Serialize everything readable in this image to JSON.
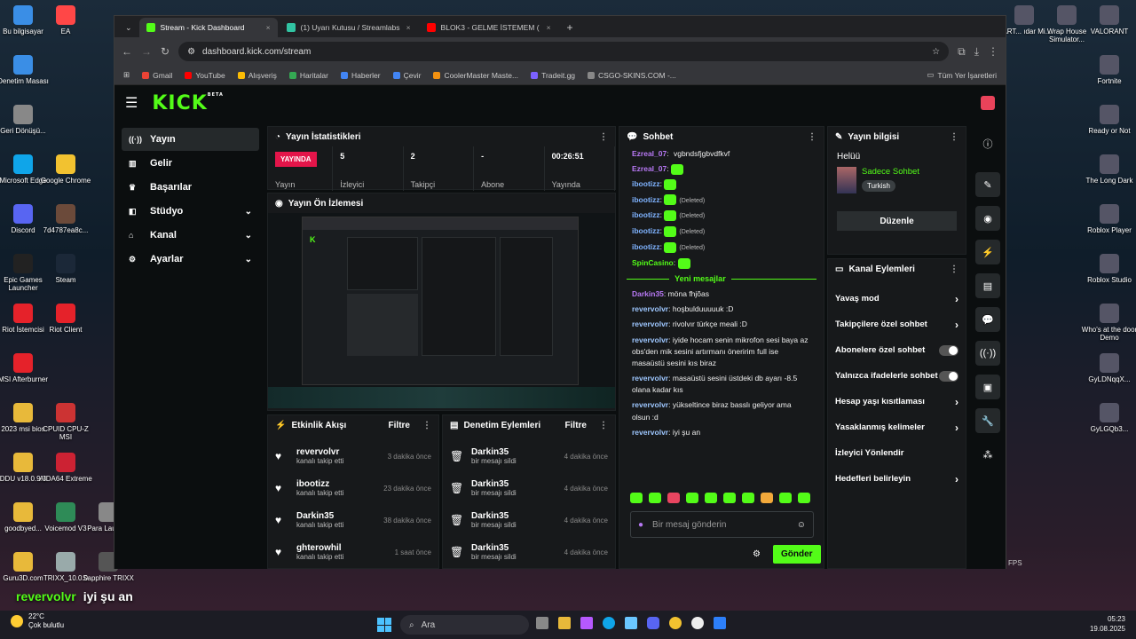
{
  "desktop": {
    "left_icons": [
      {
        "label": "Bu bilgisayar"
      },
      {
        "label": "EA"
      },
      {
        "label": "Denetim Masası"
      },
      {
        "label": "Geri Dönüşü..."
      },
      {
        "label": "Microsoft Edge"
      },
      {
        "label": "Google Chrome"
      },
      {
        "label": "Discord"
      },
      {
        "label": "7d4787ea8c..."
      },
      {
        "label": "Epic Games Launcher"
      },
      {
        "label": "Steam"
      },
      {
        "label": "Riot İstemcisi"
      },
      {
        "label": "Riot Client"
      },
      {
        "label": "MSI Afterburner"
      },
      {
        "label": "2023 msi bios"
      },
      {
        "label": "CPUID CPU-Z MSI"
      },
      {
        "label": "DDU v18.0.9.3"
      },
      {
        "label": "AIDA64 Extreme"
      },
      {
        "label": "goodbyed..."
      },
      {
        "label": "Voicemod V3"
      },
      {
        "label": "Para Launc..."
      },
      {
        "label": "Guru3D.com"
      },
      {
        "label": "TRIXX_10.0.0"
      },
      {
        "label": "Sapphire TRIXX"
      }
    ],
    "right_icons": [
      {
        "label": "HART... ıdar Mi..."
      },
      {
        "label": "Wrap House Simulator..."
      },
      {
        "label": "VALORANT"
      },
      {
        "label": "Fortnite"
      },
      {
        "label": "Ready or Not"
      },
      {
        "label": "The Long Dark"
      },
      {
        "label": "Roblox Player"
      },
      {
        "label": "Roblox Studio"
      },
      {
        "label": "Who's at the door Demo"
      },
      {
        "label": "GyLDNqqX..."
      },
      {
        "label": "GyLGQb3..."
      }
    ],
    "overlay_chat": {
      "user": "revervolvr",
      "message": "iyi şu an"
    },
    "fps_label": "FPS",
    "weather": {
      "temp": "22°C",
      "desc": "Çok bulutlu"
    },
    "taskbar": {
      "search_placeholder": "Ara",
      "time": "05:23",
      "date": "19.08.2025"
    }
  },
  "browser": {
    "tabs": [
      {
        "title": "Stream - Kick Dashboard",
        "color": "#53fc18",
        "active": true
      },
      {
        "title": "(1) Uyarı Kutusu / Streamlabs",
        "color": "#31c3a2",
        "active": false
      },
      {
        "title": "BLOK3 - GELME İSTEMEM (",
        "color": "#ff0000",
        "active": false
      }
    ],
    "url": "dashboard.kick.com/stream",
    "bookmarks": [
      {
        "label": "Gmail",
        "color": "#ea4335"
      },
      {
        "label": "YouTube",
        "color": "#ff0000"
      },
      {
        "label": "Alışveriş",
        "color": "#fbbc04"
      },
      {
        "label": "Haritalar",
        "color": "#34a853"
      },
      {
        "label": "Haberler",
        "color": "#4285f4"
      },
      {
        "label": "Çevir",
        "color": "#4285f4"
      },
      {
        "label": "CoolerMaster Maste...",
        "color": "#f29111"
      },
      {
        "label": "Tradeit.gg",
        "color": "#7b61ff"
      },
      {
        "label": "CSGO-SKINS.COM -...",
        "color": "#888888"
      }
    ],
    "all_bookmarks": "Tüm Yer İşaretleri"
  },
  "kick": {
    "logo": "KICK",
    "beta": "BETA",
    "nav": [
      {
        "label": "Yayın",
        "icon": "broadcast-icon",
        "active": true,
        "expand": false
      },
      {
        "label": "Gelir",
        "icon": "chart-icon",
        "active": false,
        "expand": false
      },
      {
        "label": "Başarılar",
        "icon": "trophy-icon",
        "active": false,
        "expand": false
      },
      {
        "label": "Stüdyo",
        "icon": "studio-icon",
        "active": false,
        "expand": true
      },
      {
        "label": "Kanal",
        "icon": "channel-icon",
        "active": false,
        "expand": true
      },
      {
        "label": "Ayarlar",
        "icon": "settings-icon",
        "active": false,
        "expand": true
      }
    ],
    "stats_panel": {
      "title": "Yayın İstatistikleri",
      "live_badge": "YAYINDA",
      "items": [
        {
          "value": "",
          "label": "Yayın"
        },
        {
          "value": "5",
          "label": "İzleyici"
        },
        {
          "value": "2",
          "label": "Takipçi"
        },
        {
          "value": "-",
          "label": "Abone"
        },
        {
          "value": "00:26:51",
          "label": "Yayında"
        }
      ]
    },
    "preview_panel": {
      "title": "Yayın Ön İzlemesi"
    },
    "activity_panel": {
      "title": "Etkinlik Akışı",
      "filter": "Filtre",
      "items": [
        {
          "name": "revervolvr",
          "sub": "kanalı takip etti",
          "time": "3 dakika önce"
        },
        {
          "name": "ibootizz",
          "sub": "kanalı takip etti",
          "time": "23 dakika önce"
        },
        {
          "name": "Darkin35",
          "sub": "kanalı takip etti",
          "time": "38 dakika önce"
        },
        {
          "name": "ghterowhil",
          "sub": "kanalı takip etti",
          "time": "1 saat önce"
        }
      ]
    },
    "moderation_panel": {
      "title": "Denetim Eylemleri",
      "filter": "Filtre",
      "items": [
        {
          "name": "Darkin35",
          "sub": "bir mesajı sildi",
          "time": "4 dakika önce"
        },
        {
          "name": "Darkin35",
          "sub": "bir mesajı sildi",
          "time": "4 dakika önce"
        },
        {
          "name": "Darkin35",
          "sub": "bir mesajı sildi",
          "time": "4 dakika önce"
        },
        {
          "name": "Darkin35",
          "sub": "bir mesajı sildi",
          "time": "4 dakika önce"
        }
      ]
    },
    "chat": {
      "title": "Sohbet",
      "top_messages": [
        {
          "user": "Ezreal_07",
          "color": "#b879f5",
          "text": "vgbndsfjgbvdfkvf",
          "emote": false,
          "deleted": false
        },
        {
          "user": "Ezreal_07",
          "color": "#b879f5",
          "text": "",
          "emote": true,
          "deleted": false
        },
        {
          "user": "ibootizz",
          "color": "#7fb3ff",
          "text": "",
          "emote": true,
          "deleted": false
        },
        {
          "user": "ibootizz",
          "color": "#7fb3ff",
          "text": "(Deleted)",
          "emote": true,
          "deleted": true
        },
        {
          "user": "ibootizz",
          "color": "#7fb3ff",
          "text": "(Deleted)",
          "emote": true,
          "deleted": true
        },
        {
          "user": "ibootizz",
          "color": "#7fb3ff",
          "text": "(Deleted)",
          "emote": true,
          "deleted": true
        },
        {
          "user": "ibootizz",
          "color": "#7fb3ff",
          "text": "(Deleted)",
          "emote": true,
          "deleted": true
        },
        {
          "user": "SpinCasino",
          "color": "#53fc18",
          "text": "",
          "emote": true,
          "deleted": false
        }
      ],
      "new_divider": "Yeni mesajlar",
      "new_messages": [
        {
          "user": "Darkin35",
          "color": "#b879f5",
          "text": "möna fhjõas"
        },
        {
          "user": "revervolvr",
          "color": "#9ec7ff",
          "text": "hoşbulduuuuuk :D"
        },
        {
          "user": "revervolvr",
          "color": "#9ec7ff",
          "text": "rivolvır türkçe meali :D"
        },
        {
          "user": "revervolvr",
          "color": "#9ec7ff",
          "text": "iyide hocam senin mikrofon sesi baya az obs'den mik sesini artırmanı öneririm full ise masaüstü sesini kıs biraz"
        },
        {
          "user": "revervolvr",
          "color": "#9ec7ff",
          "text": "masaüstü sesini üstdeki db ayarı -8.5 olana kadar kıs"
        },
        {
          "user": "revervolvr",
          "color": "#9ec7ff",
          "text": "yükseltince biraz basslı geliyor ama olsun :d"
        },
        {
          "user": "revervolvr",
          "color": "#9ec7ff",
          "text": "iyi şu an"
        }
      ],
      "input_placeholder": "Bir mesaj gönderin",
      "send_label": "Gönder"
    },
    "info_panel": {
      "title": "Yayın bilgisi",
      "stream_title": "Helüü",
      "category": "Sadece Sohbet",
      "language": "Turkish",
      "edit_label": "Düzenle"
    },
    "channel_actions": {
      "title": "Kanal Eylemleri",
      "items": [
        {
          "label": "Yavaş mod",
          "kind": "arrow"
        },
        {
          "label": "Takipçilere özel sohbet",
          "kind": "arrow"
        },
        {
          "label": "Abonelere özel sohbet",
          "kind": "toggle"
        },
        {
          "label": "Yalnızca ifadelerle sohbet",
          "kind": "toggle"
        },
        {
          "label": "Hesap yaşı kısıtlaması",
          "kind": "arrow"
        },
        {
          "label": "Yasaklanmış kelimeler",
          "kind": "arrow"
        },
        {
          "label": "İzleyici Yönlendir",
          "kind": "none"
        },
        {
          "label": "Hedefleri belirleyin",
          "kind": "arrow"
        }
      ]
    }
  }
}
